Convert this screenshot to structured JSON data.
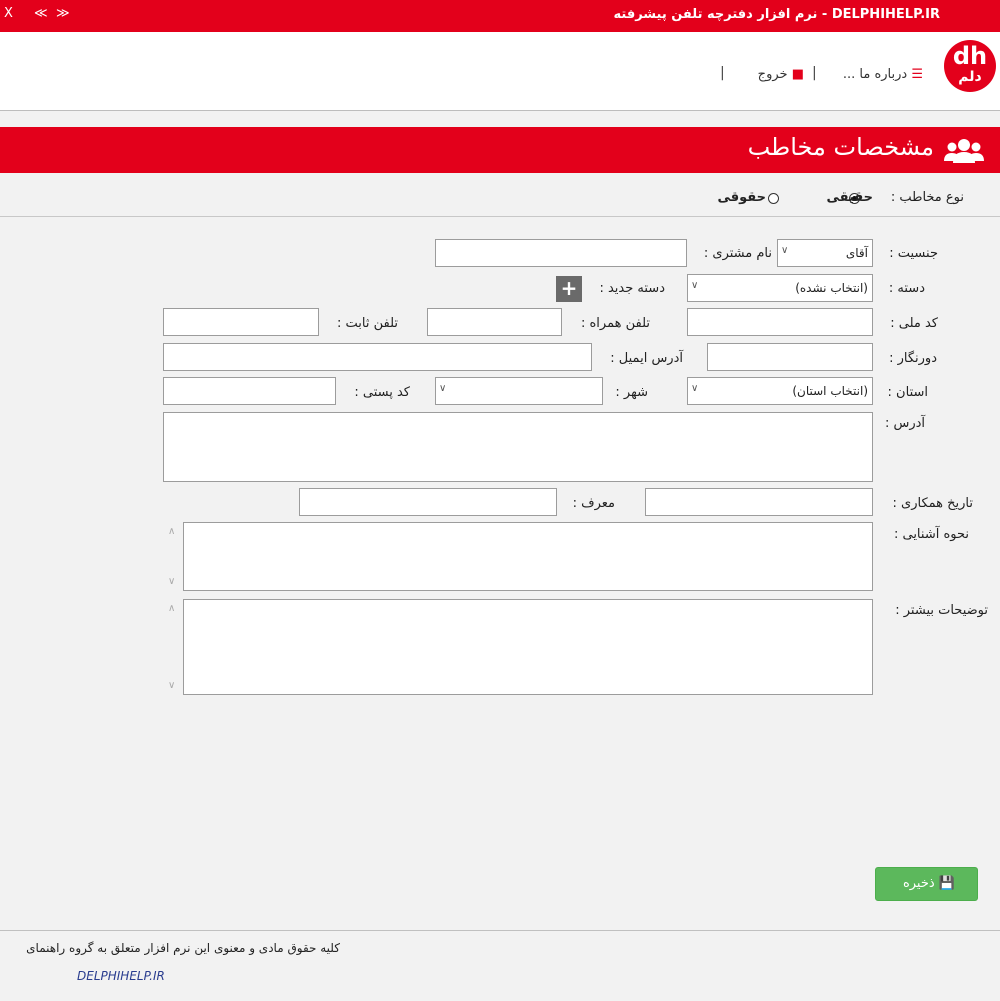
{
  "window": {
    "title": "DELPHIHELP.IR - نرم افزار دفترچه تلفن پیشرفته",
    "close_label": "X",
    "collapse_label": "≪",
    "expand_label": "≫"
  },
  "logo": {
    "line1": "dh",
    "line2": "دلم"
  },
  "toolbar": {
    "about_label": "درباره ما ...",
    "exit_label": "خروج",
    "separator": "|"
  },
  "header": {
    "title": "مشخصات مخاطب"
  },
  "contact_type": {
    "label": "نوع مخاطب :",
    "options": [
      "حقیقی",
      "حقوقی"
    ],
    "selected": "حقیقی"
  },
  "form": {
    "gender_label": "جنسیت :",
    "gender_value": "آقای",
    "customer_name_label": "نام مشتری :",
    "customer_name_value": "",
    "category_label": "دسته :",
    "category_value": "(انتخاب نشده)",
    "new_category_label": "دسته جدید :",
    "national_code_label": "کد ملی :",
    "national_code_value": "",
    "mobile_label": "تلفن همراه :",
    "mobile_value": "",
    "phone_label": "تلفن ثابت :",
    "phone_value": "",
    "fax_label": "دورنگار :",
    "fax_value": "",
    "email_label": "آدرس ایمیل :",
    "email_value": "",
    "province_label": "استان :",
    "province_value": "(انتخاب استان)",
    "city_label": "شهر :",
    "city_value": "",
    "postal_code_label": "کد پستی :",
    "postal_code_value": "",
    "address_label": "آدرس :",
    "address_value": "",
    "coop_date_label": "تاریخ همکاری :",
    "coop_date_value": "",
    "referrer_label": "معرف :",
    "referrer_value": "",
    "acquaintance_label": "نحوه آشنایی :",
    "acquaintance_value": "",
    "notes_label": "توضیحات بیشتر :",
    "notes_value": ""
  },
  "actions": {
    "save_label": "ذخیره"
  },
  "footer": {
    "copyright": "کلیه حقوق مادی و معنوی این نرم افزار متعلق به گروه راهنمای",
    "site": "DELPHIHELP.IR"
  },
  "colors": {
    "brand": "#e3001b",
    "save": "#5cb85c",
    "link": "#2a3d8f"
  }
}
